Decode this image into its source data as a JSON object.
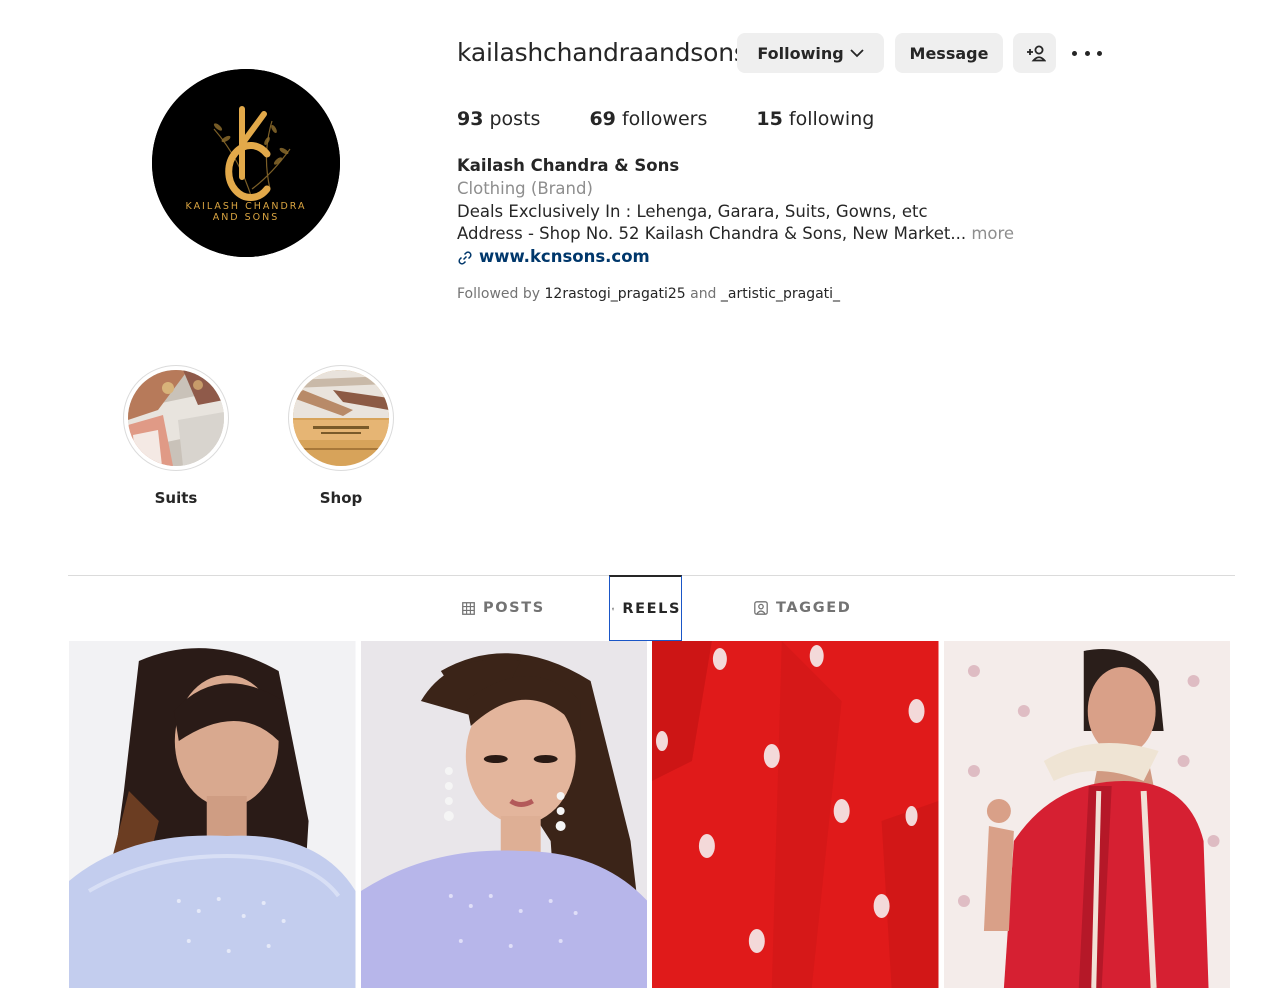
{
  "profile": {
    "username": "kailashchandraandsons",
    "full_name": "Kailash Chandra & Sons",
    "category": "Clothing (Brand)",
    "bio_line1": "Deals Exclusively In : Lehenga, Garara, Suits, Gowns, etc",
    "bio_line2": "Address - Shop No. 52 Kailash Chandra & Sons, New Market...",
    "more_label": "more",
    "website": "www.kcnsons.com",
    "followed_by_prefix": "Followed by",
    "followed_by_user1": "12rastogi_pragati25",
    "followed_by_and": "and",
    "followed_by_user2": "_artistic_pragati_",
    "logo_text_line1": "KAILASH CHANDRA",
    "logo_text_line2": "AND SONS",
    "logo_initials": "KC"
  },
  "actions": {
    "following_label": "Following",
    "message_label": "Message"
  },
  "stats": {
    "posts_count": "93",
    "posts_label": "posts",
    "followers_count": "69",
    "followers_label": "followers",
    "following_count": "15",
    "following_label": "following"
  },
  "highlights": [
    {
      "label": "Suits"
    },
    {
      "label": "Shop"
    }
  ],
  "tabs": [
    {
      "label": "POSTS",
      "active": false
    },
    {
      "label": "REELS",
      "active": true
    },
    {
      "label": "TAGGED",
      "active": false
    }
  ],
  "colors": {
    "link": "#00376b",
    "secondary_text": "#8e8e8e",
    "button_bg": "#efefef",
    "logo_gold": "#d9a441"
  },
  "icons": {
    "following_chevron": "chevron-down-icon",
    "add_user": "add-user-icon",
    "more": "more-horizontal-icon",
    "link": "link-icon",
    "posts_tab": "grid-icon",
    "reels_tab": "reels-icon",
    "tagged_tab": "tagged-user-icon"
  }
}
